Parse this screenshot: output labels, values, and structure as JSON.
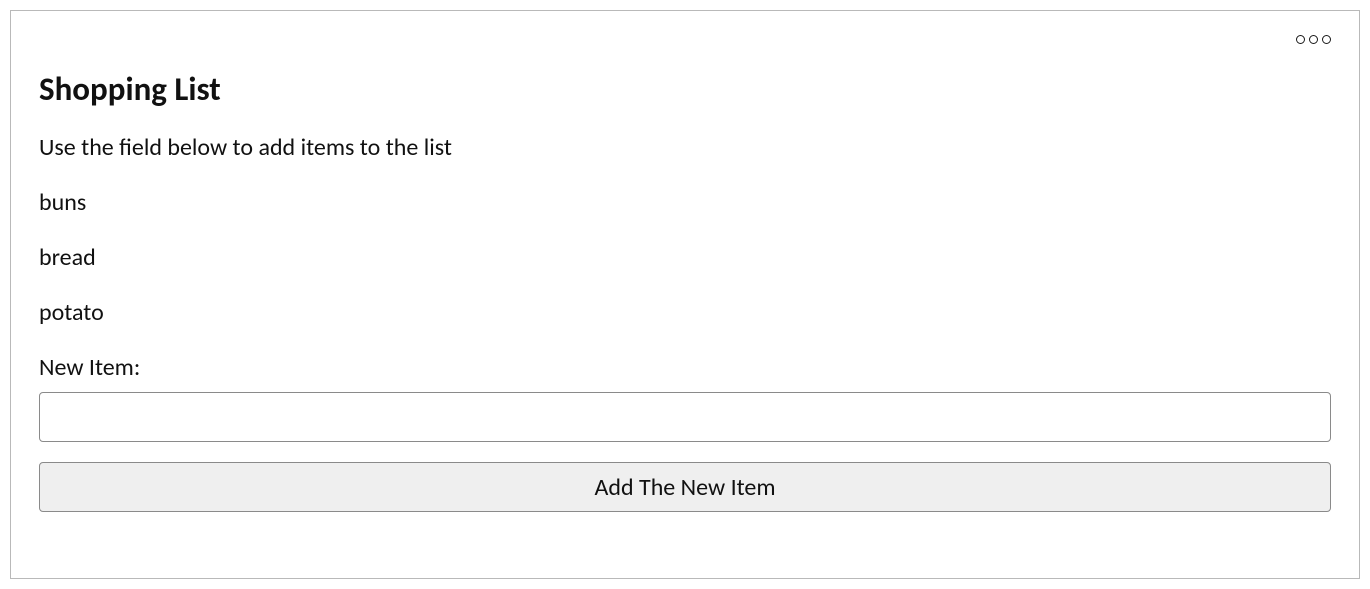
{
  "header": {
    "title": "Shopping List",
    "description": "Use the field below to add items to the list"
  },
  "list": {
    "items": [
      "buns",
      "bread",
      "potato"
    ]
  },
  "form": {
    "label": "New Item:",
    "input_value": "",
    "button_label": "Add The New Item"
  }
}
